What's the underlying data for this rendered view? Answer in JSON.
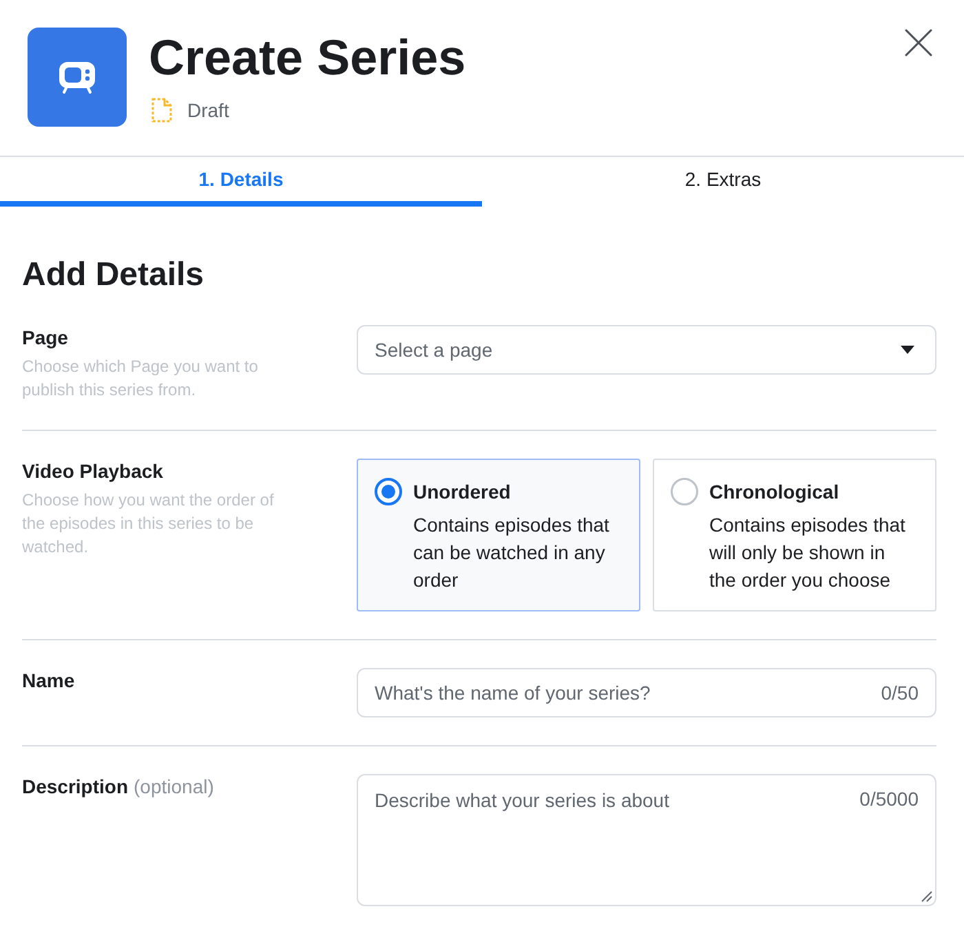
{
  "header": {
    "title": "Create Series",
    "status": "Draft"
  },
  "tabs": [
    {
      "label": "1. Details",
      "selected": true
    },
    {
      "label": "2. Extras",
      "selected": false
    }
  ],
  "section_title": "Add Details",
  "fields": [
    {
      "kind": "select",
      "label": "Page",
      "help": "Choose which Page you want to publish this series from.",
      "placeholder": "Select a page"
    },
    {
      "kind": "radio_cards",
      "label": "Video Playback",
      "help": "Choose how you want the order of the episodes in this series to be watched.",
      "options": [
        {
          "title": "Unordered",
          "description": "Contains episodes that can be watched in any order",
          "selected": true
        },
        {
          "title": "Chronological",
          "description": "Contains episodes that will only be shown in the order you choose",
          "selected": false
        }
      ]
    },
    {
      "kind": "text",
      "label": "Name",
      "placeholder": "What's the name of your series?",
      "counter": "0/50"
    },
    {
      "kind": "textarea",
      "label": "Description",
      "optional": "(optional)",
      "placeholder": "Describe what your series is about",
      "counter": "0/5000"
    }
  ]
}
